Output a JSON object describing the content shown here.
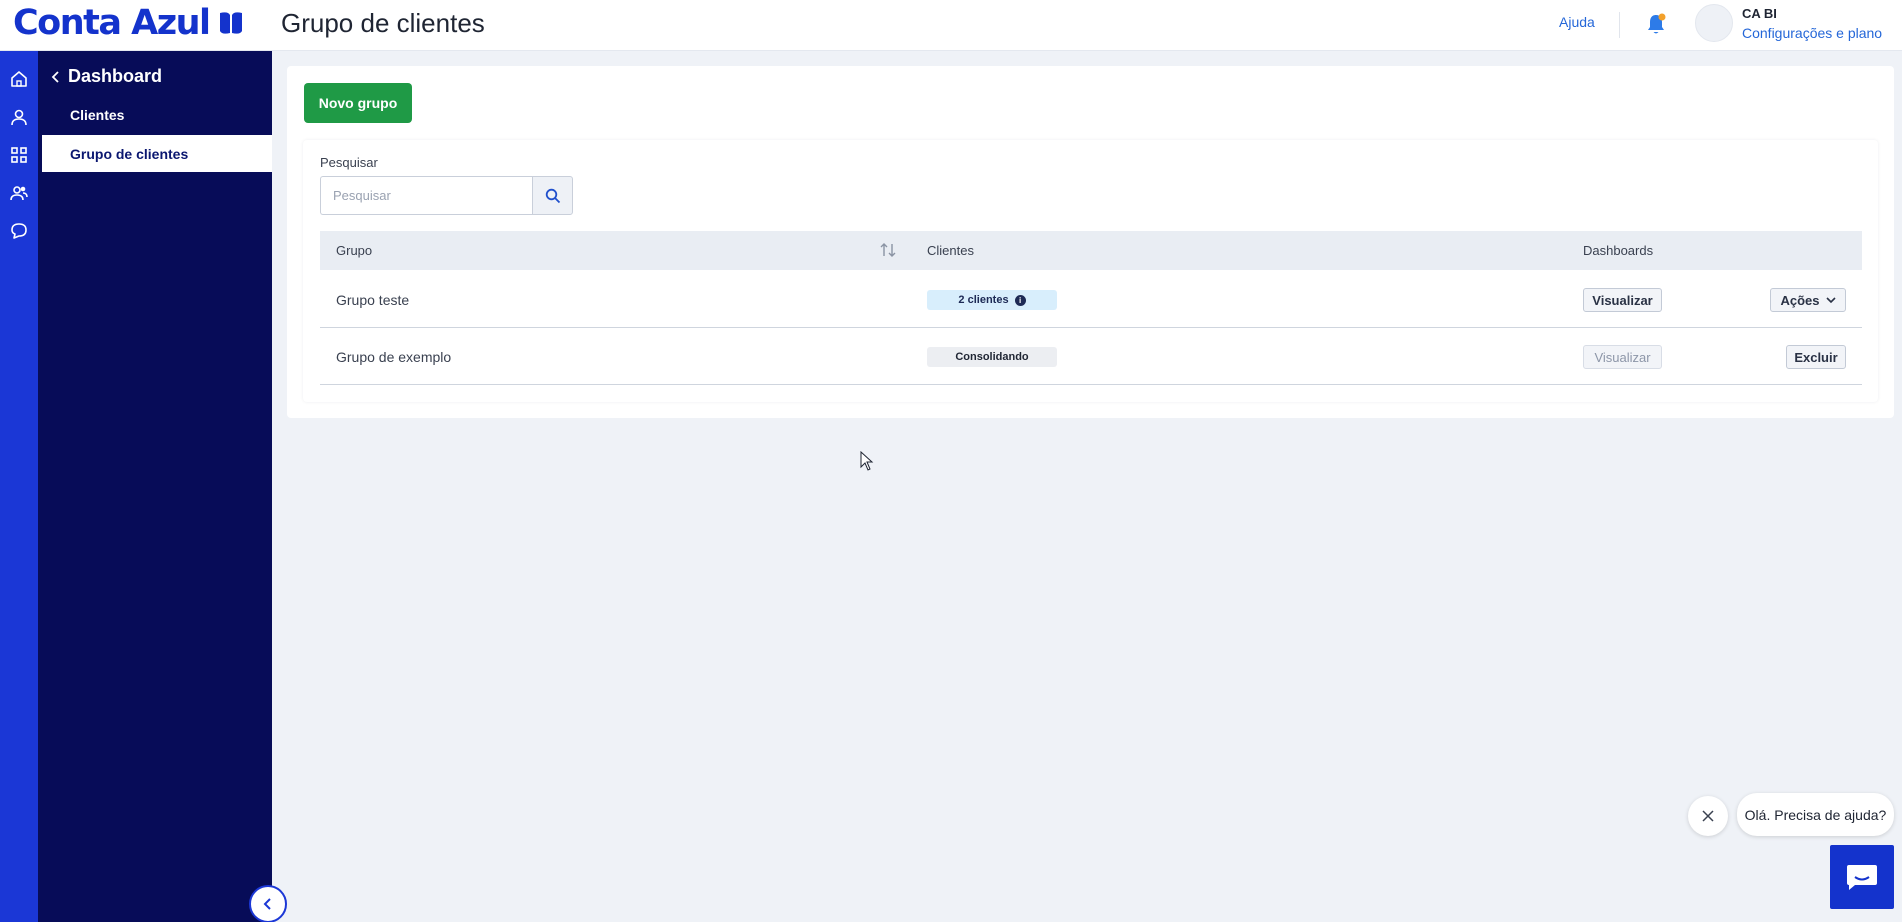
{
  "header": {
    "logo_text": "Conta Azul",
    "title": "Grupo de clientes",
    "help": "Ajuda",
    "user_name": "CA BI",
    "user_link": "Configurações e plano"
  },
  "rail": {
    "icons": [
      "home-icon",
      "user-icon",
      "grid-icon",
      "users-icon",
      "chat-icon"
    ]
  },
  "sidebar": {
    "back_label": "Dashboard",
    "items": [
      {
        "label": "Clientes",
        "active": false
      },
      {
        "label": "Grupo de clientes",
        "active": true
      }
    ]
  },
  "main": {
    "new_group_label": "Novo grupo",
    "search": {
      "label": "Pesquisar",
      "placeholder": "Pesquisar"
    },
    "table": {
      "columns": [
        "Grupo",
        "Clientes",
        "Dashboards"
      ],
      "rows": [
        {
          "grupo": "Grupo teste",
          "clientes": "2 clientes",
          "dashboards": "Visualizar",
          "action": "Ações"
        },
        {
          "grupo": "Grupo de exemplo",
          "clientes": "Consolidando",
          "dashboards": "Visualizar",
          "action": "Excluir"
        }
      ]
    }
  },
  "chat": {
    "bubble": "Olá. Precisa de ajuda?"
  },
  "colors": {
    "brand_blue": "#1433cc",
    "sidebar_navy": "#070c58",
    "success_green": "#1f9a46"
  }
}
